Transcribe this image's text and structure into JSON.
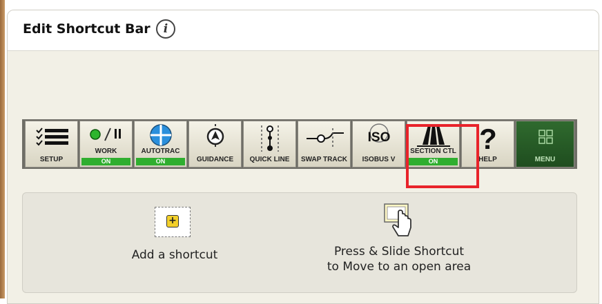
{
  "header": {
    "title": "Edit Shortcut Bar",
    "info_icon_text": "i"
  },
  "shortcut_bar": {
    "items": [
      {
        "label": "SETUP",
        "icon": "setup-list-icon",
        "state": ""
      },
      {
        "label": "WORK",
        "icon": "work-play-pause-icon",
        "state": "ON"
      },
      {
        "label": "AUTOTRAC",
        "icon": "autotrac-steering-icon",
        "state": "ON"
      },
      {
        "label": "GUIDANCE",
        "icon": "guidance-icon",
        "state": ""
      },
      {
        "label": "QUICK LINE",
        "icon": "quick-line-icon",
        "state": ""
      },
      {
        "label": "SWAP TRACK",
        "icon": "swap-track-icon",
        "state": ""
      },
      {
        "label": "ISOBUS V",
        "icon": "iso-icon",
        "state": "",
        "icon_text": "ISO"
      },
      {
        "label": "SECTION CTL",
        "icon": "section-control-icon",
        "state": "ON"
      },
      {
        "label": "HELP",
        "icon": "help-question-icon",
        "state": "",
        "icon_text": "?"
      },
      {
        "label": "MENU",
        "icon": "menu-grid-icon",
        "state": ""
      }
    ],
    "highlighted_item": "SECTION CTL",
    "highlight_color": "#e8232a",
    "on_color": "#2fae2f"
  },
  "instructions": {
    "add_label": "Add a shortcut",
    "add_icon_symbol": "+",
    "move_line1": "Press & Slide Shortcut",
    "move_line2": "to Move to an open area"
  }
}
